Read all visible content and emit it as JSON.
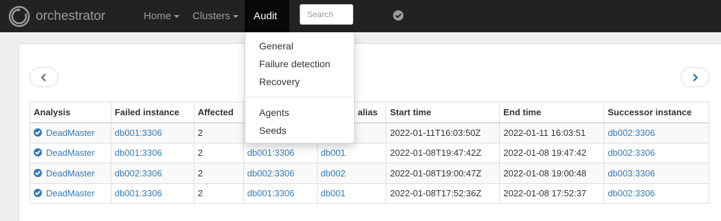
{
  "brand": {
    "name": "orchestrator",
    "icon": "orchestrator-logo-icon"
  },
  "nav": {
    "home": "Home",
    "clusters": "Clusters",
    "audit": "Audit",
    "search_placeholder": "Search",
    "status_icon": "check-circle-icon"
  },
  "audit_menu": [
    "General",
    "Failure detection",
    "Recovery",
    "Agents",
    "Seeds"
  ],
  "pager": {
    "prev_icon": "chevron-left-icon",
    "next_icon": "chevron-right-icon"
  },
  "table": {
    "headers": [
      "Analysis",
      "Failed instance",
      "Affected",
      "Failed alias",
      "Failed alias",
      "Start time",
      "End time",
      "Successor instance"
    ],
    "visible_headers": {
      "analysis": "Analysis",
      "failed_instance": "Failed instance",
      "affected": "Affected",
      "cluster_alias": "alias",
      "start_time": "Start time",
      "end_time": "End time",
      "successor": "Successor instance"
    },
    "rows": [
      {
        "analysis": "DeadMaster",
        "failed": "db001:3306",
        "affected": "2",
        "cluster": "",
        "alias": "",
        "start": "2022-01-11T16:03:50Z",
        "end": "2022-01-11 16:03:51",
        "successor": "db002:3306"
      },
      {
        "analysis": "DeadMaster",
        "failed": "db001:3306",
        "affected": "2",
        "cluster": "db001:3306",
        "alias": "db001",
        "start": "2022-01-08T19:47:42Z",
        "end": "2022-01-08 19:47:42",
        "successor": "db002:3306"
      },
      {
        "analysis": "DeadMaster",
        "failed": "db002:3306",
        "affected": "2",
        "cluster": "db002:3306",
        "alias": "db002",
        "start": "2022-01-08T19:00:47Z",
        "end": "2022-01-08 19:00:48",
        "successor": "db003:3306"
      },
      {
        "analysis": "DeadMaster",
        "failed": "db001:3306",
        "affected": "2",
        "cluster": "db001:3306",
        "alias": "db001",
        "start": "2022-01-08T17:52:36Z",
        "end": "2022-01-08 17:52:37",
        "successor": "db002:3306"
      }
    ]
  }
}
